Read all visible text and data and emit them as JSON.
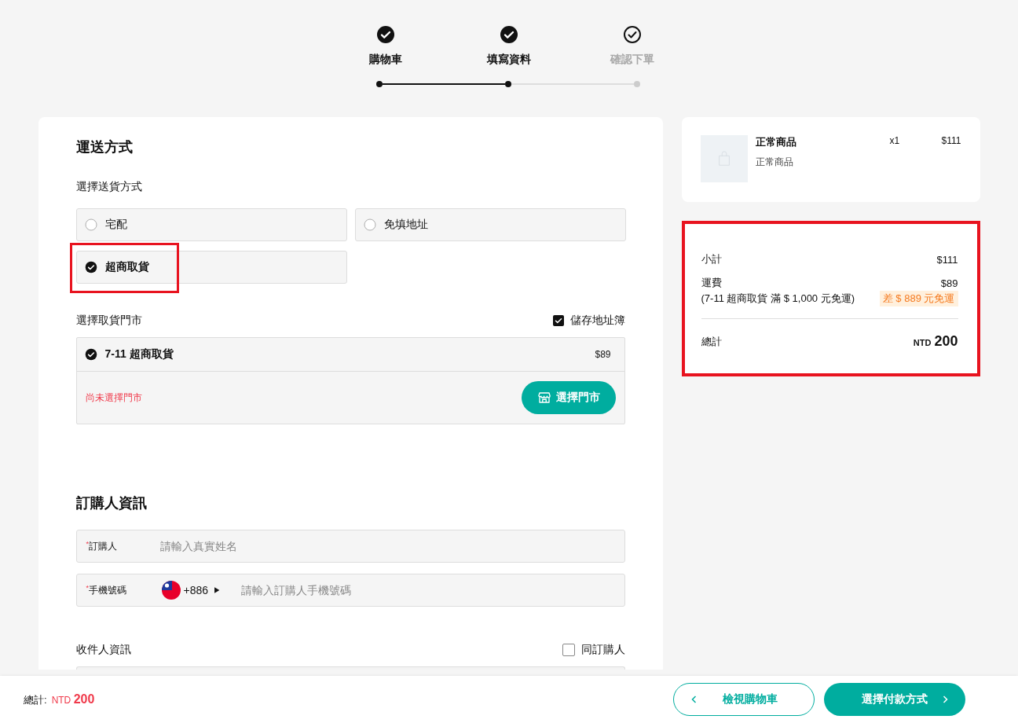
{
  "steps": [
    {
      "label": "購物車",
      "completed": true
    },
    {
      "label": "填寫資料",
      "completed": true
    },
    {
      "label": "確認下單",
      "completed": false
    }
  ],
  "shipping": {
    "title": "運送方式",
    "method_label": "選擇送貨方式",
    "methods": [
      {
        "label": "宅配",
        "selected": false,
        "highlighted": false
      },
      {
        "label": "免填地址",
        "selected": false,
        "highlighted": false
      },
      {
        "label": "超商取貨",
        "selected": true,
        "highlighted": true
      }
    ],
    "store_label": "選擇取貨門市",
    "save_address": {
      "label": "儲存地址簿",
      "checked": true
    },
    "store": {
      "name": "7-11 超商取貨",
      "selected": true,
      "price": "$89",
      "status": "尚未選擇門市",
      "button": "選擇門市"
    }
  },
  "buyer": {
    "title": "訂購人資訊",
    "fields": [
      {
        "kind": "text",
        "required_mark": "*",
        "label": "訂購人",
        "placeholder": "請輸入真實姓名"
      },
      {
        "kind": "phone",
        "required_mark": "*",
        "label": "手機號碼",
        "country_code": "+886",
        "placeholder": "請輸入訂購人手機號碼"
      }
    ]
  },
  "recipient": {
    "title": "收件人資訊",
    "same_as_buyer": {
      "label": "同訂購人",
      "checked": false
    }
  },
  "cart_item": {
    "name": "正常商品",
    "variant": "正常商品",
    "quantity": "x1",
    "price": "$111"
  },
  "summary": {
    "highlighted": true,
    "subtotal_label": "小計",
    "subtotal": "$111",
    "shipping_label": "運費",
    "shipping": "$89",
    "shipping_note": "(7-11 超商取貨 滿 $ 1,000 元免運)",
    "free_shipping_badge": "差 $ 889 元免運",
    "total_label": "總計",
    "total_currency": "NTD",
    "total": "200"
  },
  "footer": {
    "total_label": "總計:",
    "currency": "NTD",
    "total": "200",
    "back_button": "檢視購物車",
    "next_button": "選擇付款方式"
  }
}
